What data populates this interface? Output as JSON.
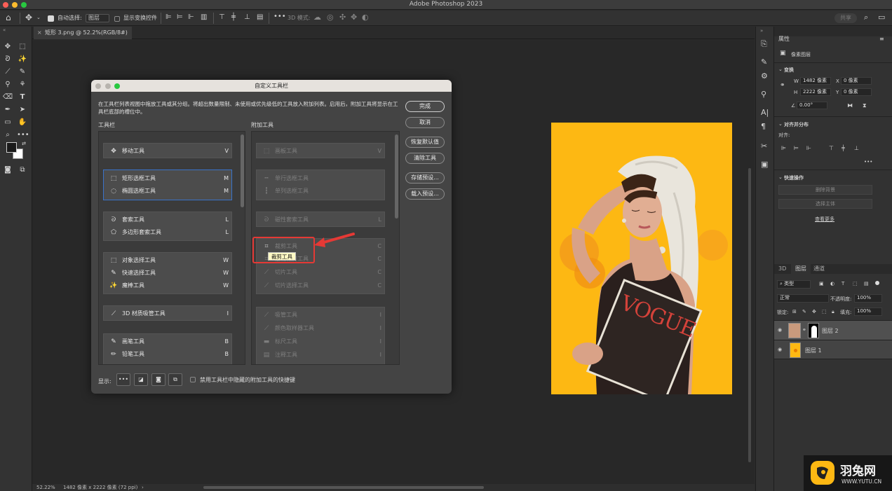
{
  "window": {
    "title": "Adobe Photoshop 2023"
  },
  "options_bar": {
    "auto_select_label": "自动选择:",
    "auto_select_value": "图层",
    "show_transform_label": "显示变换控件",
    "mode_3d_label": "3D 模式:",
    "share_label": "共享"
  },
  "document_tab": {
    "label": "矩形 3.png @ 52.2%(RGB/8#) *"
  },
  "status_bar": {
    "zoom": "52.22%",
    "info": "1482 像素 x 2222 像素 (72 ppi)"
  },
  "dialog": {
    "title": "自定义工具栏",
    "description": "在工具栏列表视图中拖放工具或其分组。将超出数量限制、未使用或优先级低的工具放入附加列表。启用后，附加工具将显示在工具栏底部的槽位中。",
    "left_header": "工具栏",
    "right_header": "附加工具",
    "toolbar_groups": [
      {
        "items": [
          {
            "icon": "move-icon",
            "name": "移动工具",
            "key": "V"
          }
        ]
      },
      {
        "items": [
          {
            "icon": "rect-marquee-icon",
            "name": "矩形选框工具",
            "key": "M"
          },
          {
            "icon": "ellipse-marquee-icon",
            "name": "椭圆选框工具",
            "key": "M"
          }
        ]
      },
      {
        "items": [
          {
            "icon": "lasso-icon",
            "name": "套索工具",
            "key": "L"
          },
          {
            "icon": "polygon-lasso-icon",
            "name": "多边形套索工具",
            "key": "L"
          }
        ]
      },
      {
        "items": [
          {
            "icon": "object-select-icon",
            "name": "对象选择工具",
            "key": "W"
          },
          {
            "icon": "quick-select-icon",
            "name": "快速选择工具",
            "key": "W"
          },
          {
            "icon": "magic-wand-icon",
            "name": "魔棒工具",
            "key": "W"
          }
        ]
      },
      {
        "items": [
          {
            "icon": "material-eyedropper-icon",
            "name": "3D 材质吸管工具",
            "key": "I"
          }
        ]
      },
      {
        "items": [
          {
            "icon": "brush-icon",
            "name": "画笔工具",
            "key": "B"
          },
          {
            "icon": "pencil-icon",
            "name": "铅笔工具",
            "key": "B"
          }
        ]
      }
    ],
    "extra_groups": [
      {
        "items": [
          {
            "icon": "artboard-icon",
            "name": "画板工具",
            "key": "V"
          }
        ]
      },
      {
        "items": [
          {
            "icon": "single-row-icon",
            "name": "单行选框工具",
            "key": ""
          },
          {
            "icon": "single-col-icon",
            "name": "单列选框工具",
            "key": ""
          }
        ]
      },
      {
        "items": [
          {
            "icon": "magnetic-lasso-icon",
            "name": "磁性套索工具",
            "key": "L"
          }
        ]
      },
      {
        "items": [
          {
            "icon": "crop-icon",
            "name": "裁剪工具",
            "key": "C"
          },
          {
            "icon": "perspective-crop-icon",
            "name": "透视裁剪工具",
            "key": "C"
          },
          {
            "icon": "slice-icon",
            "name": "切片工具",
            "key": "C"
          },
          {
            "icon": "slice-select-icon",
            "name": "切片选择工具",
            "key": "C"
          }
        ]
      },
      {
        "items": [
          {
            "icon": "eyedropper-icon",
            "name": "吸管工具",
            "key": "I"
          },
          {
            "icon": "color-sampler-icon",
            "name": "颜色取样器工具",
            "key": "I"
          },
          {
            "icon": "ruler-icon",
            "name": "标尺工具",
            "key": "I"
          },
          {
            "icon": "note-icon",
            "name": "注释工具",
            "key": "I"
          }
        ]
      }
    ],
    "buttons": {
      "done": "完成",
      "cancel": "取消",
      "restore": "恢复默认值",
      "clear": "清除工具",
      "save_preset": "存储预设...",
      "load_preset": "载入预设..."
    },
    "footer": {
      "show_label": "显示:",
      "disable_shortcuts_label": "禁用工具栏中隐藏的附加工具的快捷键"
    },
    "tooltip": "裁剪工具"
  },
  "properties": {
    "tab": "属性",
    "kind": "像素图层",
    "transform_header": "变换",
    "w_label": "W",
    "w_value": "1482 像素",
    "h_label": "H",
    "h_value": "2222 像素",
    "x_label": "X",
    "x_value": "0 像素",
    "y_label": "Y",
    "y_value": "0 像素",
    "angle_value": "0.00°",
    "align_header": "对齐并分布",
    "align_label": "对齐:",
    "more": "•••",
    "quick_actions_header": "快速操作",
    "remove_bg": "删除背景",
    "select_subject": "选择主体",
    "learn_more": "查看更多"
  },
  "layers": {
    "tabs": [
      "3D",
      "图层",
      "通道"
    ],
    "filter": "类型",
    "blend_mode": "正常",
    "opacity_label": "不透明度:",
    "opacity_value": "100%",
    "lock_label": "锁定:",
    "fill_label": "填充:",
    "fill_value": "100%",
    "items": [
      {
        "name": "图层 2"
      },
      {
        "name": "图层 1"
      }
    ]
  },
  "watermark": {
    "text": "羽兔网",
    "url": "WWW.YUTU.CN"
  },
  "colors": {
    "photo_bg": "#fdb813",
    "accent_blue": "#3a73c9",
    "highlight_red": "#e53935"
  }
}
